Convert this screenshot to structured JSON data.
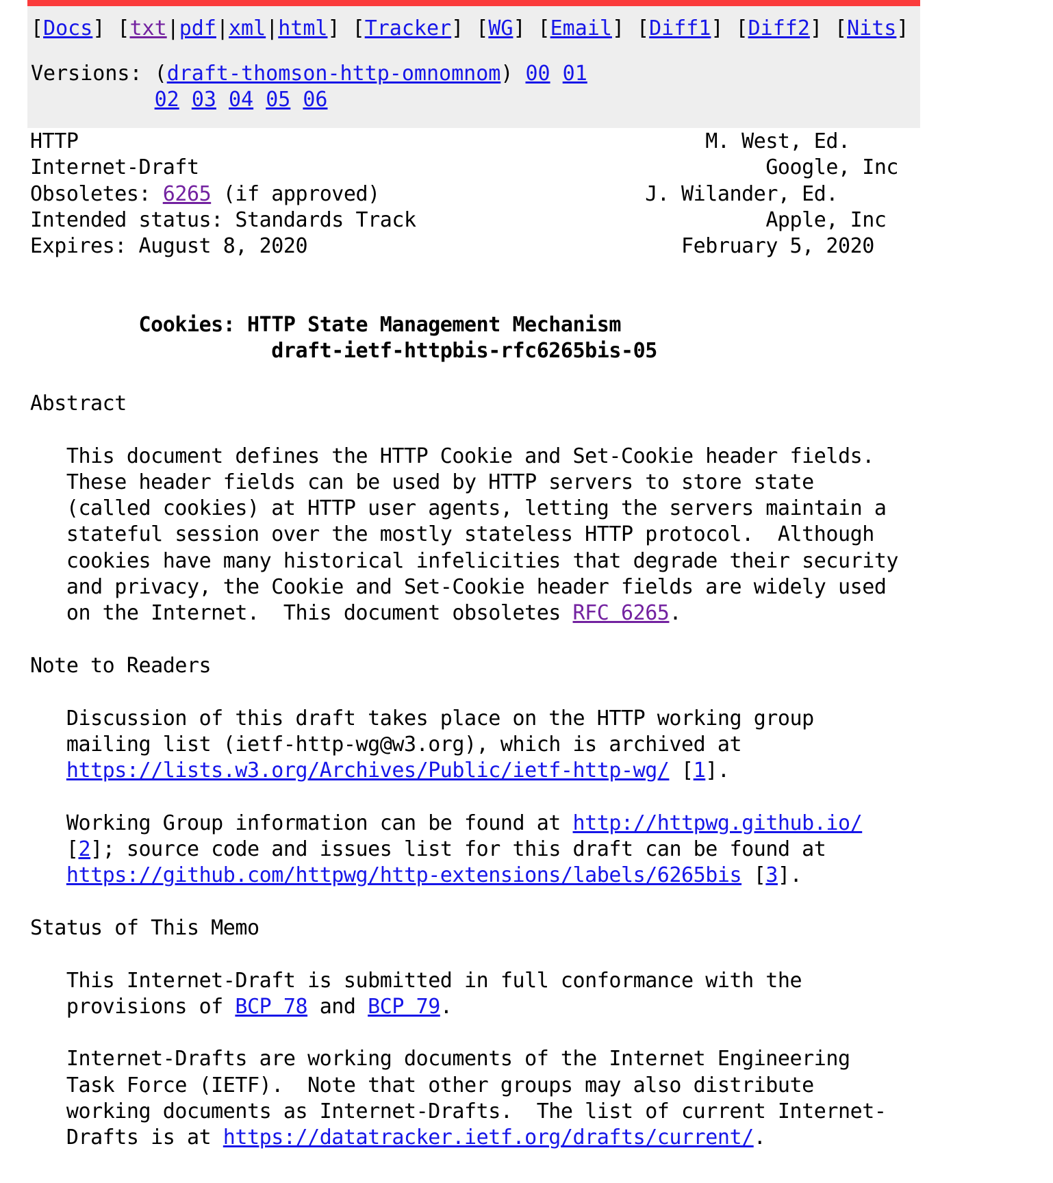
{
  "theme": {
    "accent_red": "#fb3b3b",
    "panel_bg": "#eeeeee",
    "link": "#1616e8",
    "link_visited": "#7322a0",
    "text": "#000000",
    "page_bg": "#ffffff"
  },
  "toolbar": {
    "groups": [
      {
        "open": "[",
        "items": [
          {
            "label": "Docs",
            "kind": "link",
            "visited": false
          }
        ],
        "close": "]"
      },
      {
        "open": "[",
        "items": [
          {
            "label": "txt",
            "kind": "link",
            "visited": true
          },
          {
            "label": "pdf",
            "kind": "link",
            "visited": false
          },
          {
            "label": "xml",
            "kind": "link",
            "visited": false
          },
          {
            "label": "html",
            "kind": "link",
            "visited": false
          }
        ],
        "close": "]",
        "sep": "|"
      },
      {
        "open": "[",
        "items": [
          {
            "label": "Tracker",
            "kind": "link",
            "visited": false
          }
        ],
        "close": "]"
      },
      {
        "open": "[",
        "items": [
          {
            "label": "WG",
            "kind": "link",
            "visited": false
          }
        ],
        "close": "]"
      },
      {
        "open": "[",
        "items": [
          {
            "label": "Email",
            "kind": "link",
            "visited": false
          }
        ],
        "close": "]"
      },
      {
        "open": "[",
        "items": [
          {
            "label": "Diff1",
            "kind": "link",
            "visited": false
          }
        ],
        "close": "]"
      },
      {
        "open": "[",
        "items": [
          {
            "label": "Diff2",
            "kind": "link",
            "visited": false
          }
        ],
        "close": "]"
      },
      {
        "open": "[",
        "items": [
          {
            "label": "Nits",
            "kind": "link",
            "visited": false
          }
        ],
        "close": "]"
      }
    ],
    "labels": {
      "docs": "Docs",
      "txt": "txt",
      "pdf": "pdf",
      "xml": "xml",
      "html": "html",
      "tracker": "Tracker",
      "wg": "WG",
      "email": "Email",
      "diff1": "Diff1",
      "diff2": "Diff2",
      "nits": "Nits"
    }
  },
  "versions": {
    "label": "Versions:",
    "base_open": "(",
    "base_name": "draft-thomson-http-omnomnom",
    "base_close": ")",
    "row1": [
      "00",
      "01"
    ],
    "row2": [
      "02",
      "03",
      "04",
      "05",
      "06"
    ]
  },
  "header": {
    "left": [
      "HTTP",
      "Internet-Draft",
      "Obsoletes: ",
      "Intended status: Standards Track",
      "Expires: August 8, 2020"
    ],
    "obsoletes_link": "6265",
    "obsoletes_suffix": " (if approved)",
    "right": [
      "M. West, Ed.",
      "Google, Inc",
      "J. Wilander, Ed.",
      "Apple, Inc",
      "February 5, 2020"
    ]
  },
  "title": {
    "line1": "Cookies: HTTP State Management Mechanism",
    "line2": "draft-ietf-httpbis-rfc6265bis-05"
  },
  "sections": {
    "abstract_heading": "Abstract",
    "abstract_lines": [
      "This document defines the HTTP Cookie and Set-Cookie header fields.",
      "These header fields can be used by HTTP servers to store state",
      "(called cookies) at HTTP user agents, letting the servers maintain a",
      "stateful session over the mostly stateless HTTP protocol.  Although",
      "cookies have many historical infelicities that degrade their security",
      "and privacy, the Cookie and Set-Cookie header fields are widely used",
      "on the Internet.  This document obsoletes "
    ],
    "abstract_rfc_link": "RFC 6265",
    "abstract_tail": ".",
    "note_heading": "Note to Readers",
    "note_p1_l1": "Discussion of this draft takes place on the HTTP working group",
    "note_p1_l2": "mailing list (ietf-http-wg@w3.org), which is archived at",
    "note_p1_url": "https://lists.w3.org/Archives/Public/ietf-http-wg/",
    "note_p1_ref_open": " [",
    "note_p1_ref": "1",
    "note_p1_ref_close": "].",
    "note_p2_l1_pre": "Working Group information can be found at ",
    "note_p2_url1": "http://httpwg.github.io/",
    "note_p2_l2_ref_open": "[",
    "note_p2_ref2": "2",
    "note_p2_l2_mid": "]; source code and issues list for this draft can be found at",
    "note_p2_url2": "https://github.com/httpwg/http-extensions/labels/6265bis",
    "note_p2_ref3_open": " [",
    "note_p2_ref3": "3",
    "note_p2_ref3_close": "].",
    "status_heading": "Status of This Memo",
    "status_p1_l1": "This Internet-Draft is submitted in full conformance with the",
    "status_p1_l2_pre": "provisions of ",
    "status_bcp78": "BCP 78",
    "status_p1_l2_mid": " and ",
    "status_bcp79": "BCP 79",
    "status_p1_l2_end": ".",
    "status_p2_l1": "Internet-Drafts are working documents of the Internet Engineering",
    "status_p2_l2": "Task Force (IETF).  Note that other groups may also distribute",
    "status_p2_l3": "working documents as Internet-Drafts.  The list of current Internet-",
    "status_p2_l4_pre": "Drafts is at ",
    "status_p2_url": "https://datatracker.ietf.org/drafts/current/",
    "status_p2_l4_end": "."
  }
}
